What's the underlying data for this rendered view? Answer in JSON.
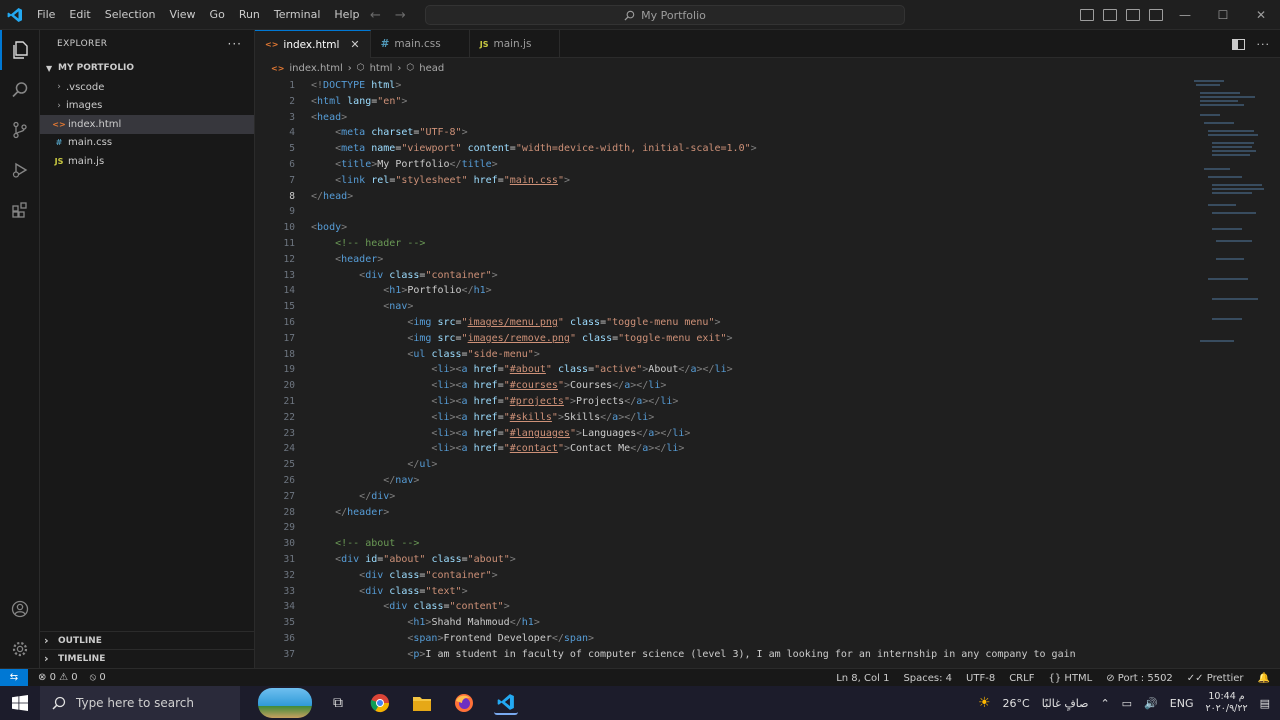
{
  "titlebar": {
    "menu": [
      "File",
      "Edit",
      "Selection",
      "View",
      "Go",
      "Run",
      "Terminal",
      "Help"
    ],
    "search": "My Portfolio"
  },
  "sidebar": {
    "title": "EXPLORER",
    "root": "MY PORTFOLIO",
    "items": [
      {
        "label": ".vscode",
        "type": "folder"
      },
      {
        "label": "images",
        "type": "folder"
      },
      {
        "label": "index.html",
        "type": "html"
      },
      {
        "label": "main.css",
        "type": "css"
      },
      {
        "label": "main.js",
        "type": "js"
      }
    ],
    "outline": "OUTLINE",
    "timeline": "TIMELINE"
  },
  "tabs": [
    {
      "label": "index.html",
      "type": "html"
    },
    {
      "label": "main.css",
      "type": "css"
    },
    {
      "label": "main.js",
      "type": "js"
    }
  ],
  "breadcrumb": [
    "index.html",
    "html",
    "head"
  ],
  "editor": {
    "line_numbers": [
      "1",
      "2",
      "3",
      "4",
      "5",
      "6",
      "7",
      "8",
      "9",
      "10",
      "11",
      "12",
      "13",
      "14",
      "15",
      "16",
      "17",
      "18",
      "19",
      "20",
      "21",
      "22",
      "23",
      "24",
      "25",
      "26",
      "27",
      "28",
      "29",
      "30",
      "31",
      "32",
      "33",
      "34",
      "35",
      "36",
      "37"
    ],
    "current_line": "8"
  },
  "statusbar": {
    "errors": "0",
    "warnings": "0",
    "ports": "0",
    "position": "Ln 8, Col 1",
    "spaces": "Spaces: 4",
    "encoding": "UTF-8",
    "eol": "CRLF",
    "language": "HTML",
    "port": "Port : 5502",
    "prettier": "Prettier"
  },
  "taskbar": {
    "search": "Type here to search",
    "weather": "26°C",
    "weather_text": "صافٍ غالبًا",
    "lang": "ENG",
    "time": "10:44 م",
    "date": "٢٠٢٠/٩/٢٢"
  },
  "colors": {
    "accent": "#0078d4",
    "editor_bg": "#1f1f1f",
    "sidebar_bg": "#181818"
  }
}
